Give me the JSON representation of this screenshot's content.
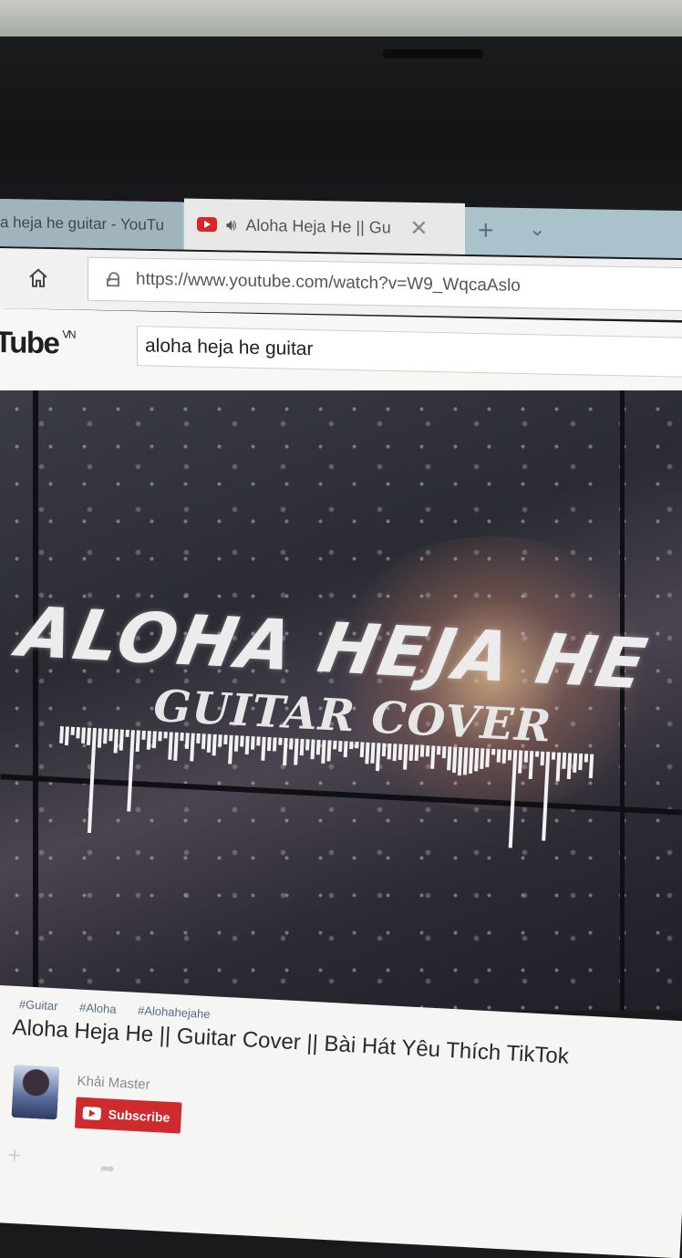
{
  "browser": {
    "tabs": [
      {
        "title": "a heja he guitar - YouTu",
        "active": false
      },
      {
        "title": "Aloha Heja He || Gu",
        "active": true,
        "audio": true
      }
    ],
    "new_tab_symbol": "+",
    "tab_list_symbol": "⌄",
    "close_symbol": "✕",
    "speaker_symbol": "🔊︎",
    "address": "https://www.youtube.com/watch?v=W9_WqcaAslo"
  },
  "youtube": {
    "logo_text": "Tube",
    "country_code": "VN",
    "search_query": "aloha heja he guitar"
  },
  "thumbnail": {
    "title": "ALOHA HEJA HE",
    "subtitle": "GUITAR COVER"
  },
  "video": {
    "hashtags": [
      "#Guitar",
      "#Aloha",
      "#Alohahejahe"
    ],
    "title": "Aloha Heja He || Guitar Cover || Bài Hát Yêu Thích TikTok",
    "channel": "Khải Master",
    "subscribe_label": "Subscribe"
  },
  "colors": {
    "youtube_red": "#d8262a",
    "tab_strip": "#a9c2cb",
    "hashtag": "#5a6a8a"
  },
  "icons": [
    "youtube-favicon",
    "speaker-icon",
    "close-icon",
    "new-tab-icon",
    "tab-list-icon",
    "home-icon",
    "lock-icon",
    "subscribe-icon",
    "add-icon",
    "share-icon"
  ]
}
